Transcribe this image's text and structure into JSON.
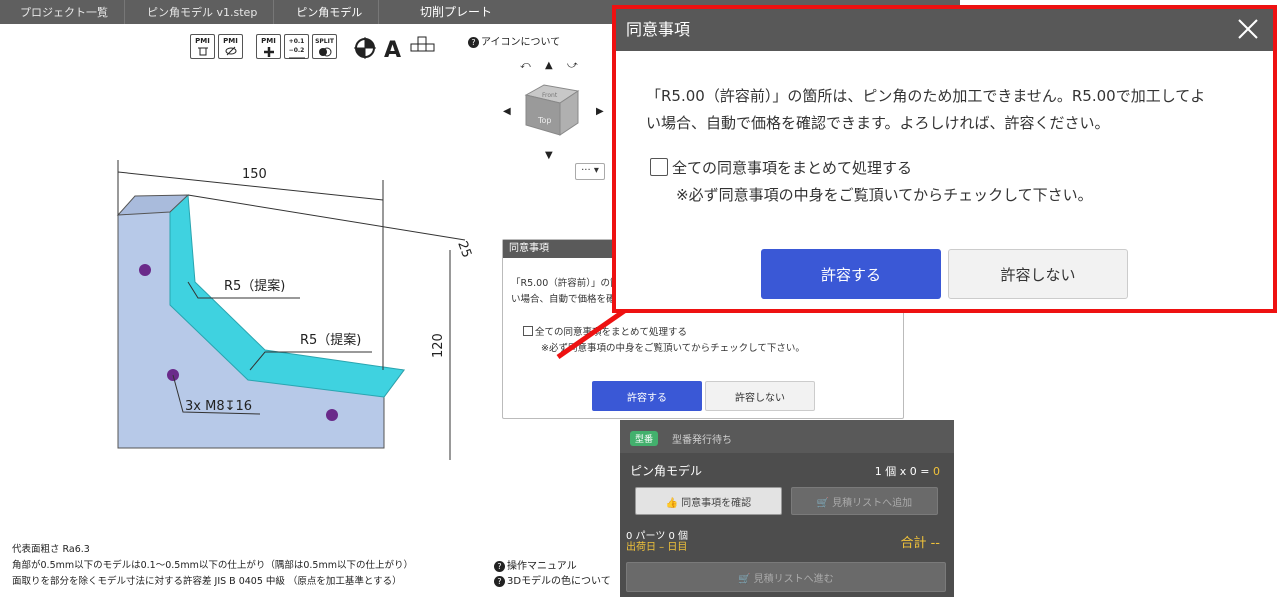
{
  "breadcrumb": {
    "items": [
      "プロジェクト一覧",
      "ピン角モデル v1.step",
      "ピン角モデル"
    ],
    "title": "切削プレート"
  },
  "toolbar": {
    "tools": [
      "PMI",
      "PMI",
      "PMI",
      "+0.1 −0.2",
      "SPLIT"
    ],
    "help_label": "アイコンについて"
  },
  "drawing": {
    "dim_width": "150",
    "dim_height": "120",
    "dim_depth": "25",
    "note_r5_a": "R5（提案)",
    "note_r5_b": "R5（提案)",
    "note_hole": "3x M8↧16"
  },
  "cube": {
    "face_front": "Top",
    "face_top": "Front"
  },
  "small_dialog": {
    "title": "同意事項",
    "text_line1": "「R5.00（許容前）」の箇所は、ピン角のため加工できません。R5.00で加工してよ",
    "text_line2": "い場合、自動で価格を確認できます。よろしければ、許容ください。",
    "check_label": "全ての同意事項をまとめて処理する",
    "note": "※必ず同意事項の中身をご覧頂いてからチェックして下さい。",
    "ok_label": "許容する",
    "ng_label": "許容しない"
  },
  "order_panel": {
    "badge": "型番",
    "badge_status": "型番発行待ち",
    "model_name": "ピン角モデル",
    "count_prefix": "1 個 x 0 = ",
    "count_value": "0",
    "confirm_button": "同意事項を確認",
    "add_quote_button": "見積リストへ追加",
    "parts_label": "0 パーツ 0 個",
    "ship_label": "出荷日 – 日目",
    "total_label": "合計 --",
    "next_button": "見積リストへ進む"
  },
  "notes": {
    "line1": "代表面粗さ Ra6.3",
    "line2": "角部が0.5mm以下のモデルは0.1〜0.5mm以下の仕上がり（隅部は0.5mm以下の仕上がり）",
    "line3": "面取りを部分を除くモデル寸法に対する許容差 JIS B 0405 中級 （原点を加工基準とする）",
    "manual_link": "操作マニュアル",
    "color_link": "3Dモデルの色について"
  },
  "zoom_dialog": {
    "title": "同意事項",
    "text_line1": "「R5.00（許容前）」の箇所は、ピン角のため加工できません。R5.00で加工してよ",
    "text_line2": "い場合、自動で価格を確認できます。よろしければ、許容ください。",
    "check_label": "全ての同意事項をまとめて処理する",
    "note": "※必ず同意事項の中身をご覧頂いてからチェックして下さい。",
    "ok_label": "許容する",
    "ng_label": "許容しない"
  },
  "colors": {
    "accent_blue": "#3a58d6",
    "highlight_red": "#ee1111",
    "model_fill": "#b7c9e8",
    "model_edge_cyan": "#3fd2e0",
    "badge_green": "#43b06d",
    "price_yellow": "#f0c23a"
  }
}
